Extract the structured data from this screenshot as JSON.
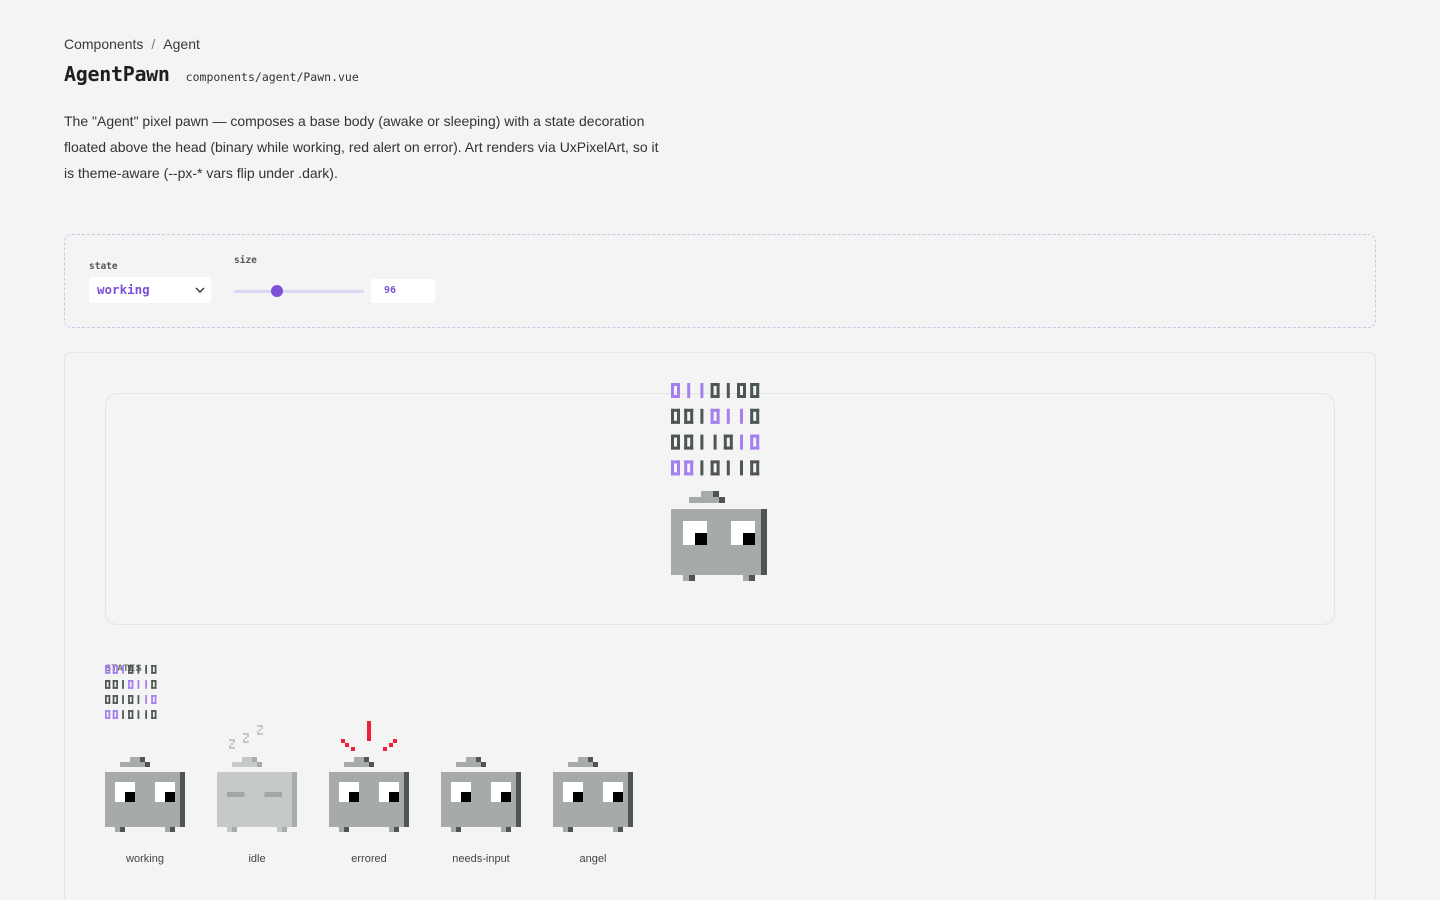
{
  "breadcrumb": {
    "items": [
      "Components",
      "Agent"
    ],
    "separator": "/"
  },
  "page": {
    "title": "AgentPawn",
    "file": "components/agent/Pawn.vue",
    "description": "The \"Agent\" pixel pawn — composes a base body (awake or sleeping) with a state decoration floated above the head (binary while working, red alert on error). Art renders via UxPixelArt, so it is theme-aware (--px-* vars flip under .dark)."
  },
  "controls": {
    "state_label": "state",
    "state_value": "working",
    "size_label": "size",
    "size_value": "96",
    "size_fraction": 0.33
  },
  "preview": {
    "state": "working",
    "binary_rows": [
      "0110100",
      "0010110",
      "0011010",
      "0010110"
    ]
  },
  "states": {
    "label": "STATES",
    "items": [
      {
        "name": "working",
        "binary_rows": [
          "0010110",
          "0010110",
          "0010110",
          "0010110"
        ]
      },
      {
        "name": "idle"
      },
      {
        "name": "errored"
      },
      {
        "name": "needs-input"
      },
      {
        "name": "angel"
      }
    ]
  },
  "colors": {
    "accent": "#7b4fd8",
    "binary_purple": "#a57ef0",
    "binary_dark": "#4d5653",
    "body": "#a6aba9",
    "body_idle": "#c5cac8",
    "shade": "#4d5653",
    "alert": "#f0203a",
    "zzz": "#c4c8c6"
  },
  "icons": {
    "select_chevron": "chevron-down-icon"
  }
}
